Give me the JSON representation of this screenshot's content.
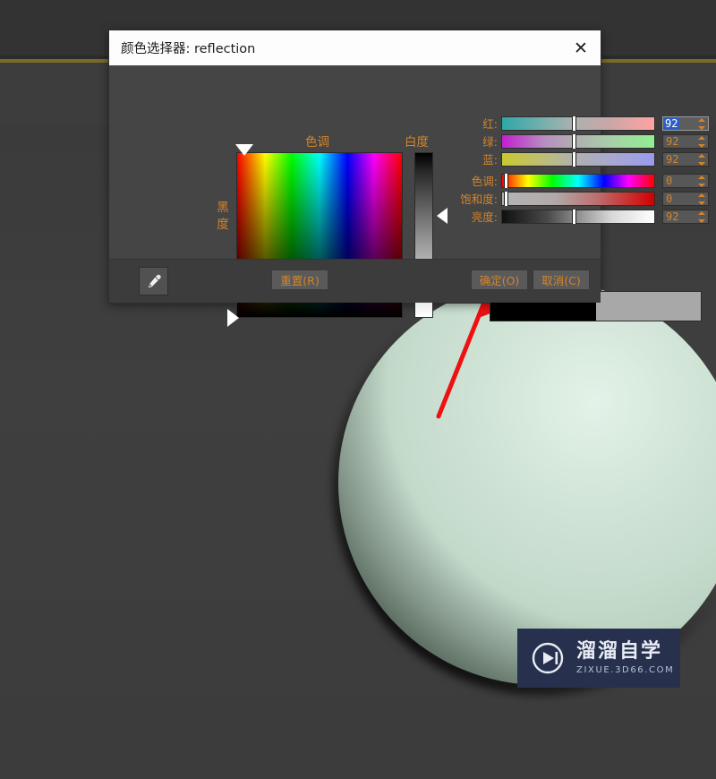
{
  "dialog": {
    "title": "颜色选择器: reflection",
    "close_icon": "close-icon",
    "labels": {
      "hue": "色调",
      "whiteness": "白度",
      "blackness": "黑度"
    },
    "sliders": [
      {
        "label": "红:",
        "value": "92",
        "thumb_pct": 46,
        "selected": true,
        "gradient": "linear-gradient(to right,#2ea8a8 0%,#7fb0ad 30%,#b0b0b0 48%,#c9a7a7 70%,#ffa2a2 100%)"
      },
      {
        "label": "绿:",
        "value": "92",
        "thumb_pct": 46,
        "selected": false,
        "gradient": "linear-gradient(to right,#c020d0 0%,#b78fc0 28%,#b0b0b0 48%,#a8cfa8 72%,#90f090 100%)"
      },
      {
        "label": "蓝:",
        "value": "92",
        "thumb_pct": 46,
        "selected": false,
        "gradient": "linear-gradient(to right,#c8c830 0%,#bdbd7a 28%,#b0b0b0 48%,#a8a8d0 72%,#9a9aee 100%)"
      },
      {
        "label": "色调:",
        "value": "0",
        "thumb_pct": 1,
        "selected": false,
        "gradient": "linear-gradient(to right,#ff0000 0%,#ffff00 17%,#00ff00 33%,#00ffff 50%,#0000ff 67%,#ff00ff 83%,#ff0000 100%)"
      },
      {
        "label": "饱和度:",
        "value": "0",
        "thumb_pct": 1,
        "selected": false,
        "gradient": "linear-gradient(to right,#b5b5b5 0%,#b2a8a8 35%,#bb7070 62%,#cc2a2a 85%,#d00000 100%)"
      },
      {
        "label": "亮度:",
        "value": "92",
        "thumb_pct": 46,
        "selected": false,
        "gradient": "linear-gradient(to right,#101010 0%,#4a4a4a 30%,#8a8a8a 48%,#d8d8d8 72%,#ffffff 100%)"
      }
    ],
    "preview": {
      "old_color": "#000000",
      "new_color": "#a8a8a8"
    },
    "buttons": {
      "eyedropper_icon": "eyedropper-icon",
      "reset": "重置(R)",
      "ok": "确定(O)",
      "cancel": "取消(C)"
    },
    "accent_color": "#d4842a",
    "selection_color": "#2b5ec2"
  },
  "viewport": {
    "background_color": "#3d3d3d",
    "sphere_color": "#c6dccd",
    "guide_line_color": "#7a6b27",
    "annotation_arrow_color": "#ee1111"
  },
  "watermark": {
    "title": "溜溜自学",
    "subtitle": "ZIXUE.3D66.COM",
    "icon": "play-circle-icon",
    "background_color": "#27314e"
  }
}
